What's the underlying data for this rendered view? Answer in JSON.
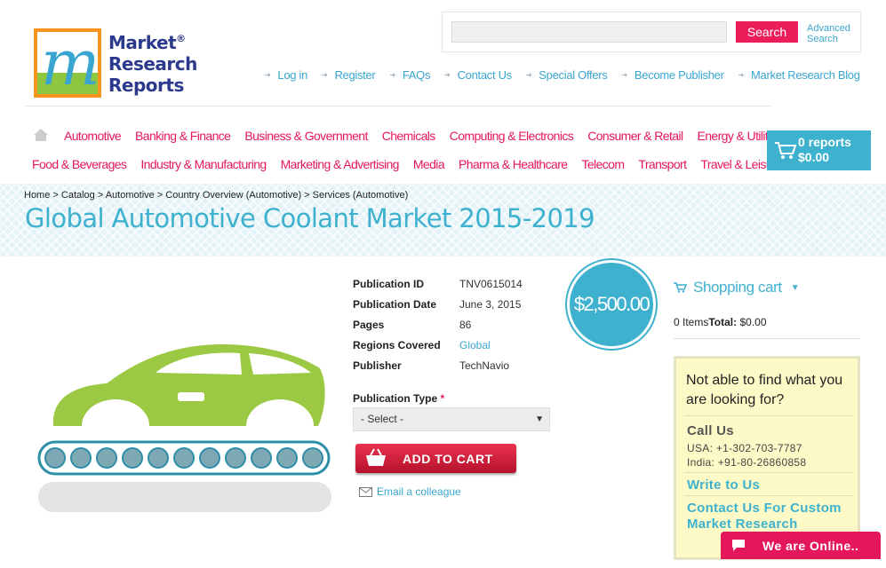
{
  "logo": {
    "line1": "Market",
    "line2": "Research",
    "line3": "Reports",
    "reg": "®"
  },
  "search": {
    "placeholder": "",
    "button": "Search",
    "advanced": "Advanced Search"
  },
  "top_links": [
    "Log in",
    "Register",
    "FAQs",
    "Contact Us",
    "Special Offers",
    "Become Publisher",
    "Market Research Blog"
  ],
  "categories_row1": [
    "Automotive",
    "Banking & Finance",
    "Business & Government",
    "Chemicals",
    "Computing & Electronics",
    "Consumer & Retail",
    "Energy & Utilities"
  ],
  "categories_row2": [
    "Food & Beverages",
    "Industry & Manufacturing",
    "Marketing & Advertising",
    "Media",
    "Pharma & Healthcare",
    "Telecom",
    "Transport",
    "Travel & Leisure"
  ],
  "cart": {
    "reports": "0 reports",
    "total": "$0.00"
  },
  "breadcrumb": "Home > Catalog > Automotive > Country Overview (Automotive) > Services (Automotive)",
  "title": "Global Automotive Coolant Market 2015-2019",
  "price": "$2,500.00",
  "details": [
    {
      "label": "Publication ID",
      "value": "TNV0615014"
    },
    {
      "label": "Publication Date",
      "value": "June 3, 2015"
    },
    {
      "label": "Pages",
      "value": "86"
    },
    {
      "label": "Regions Covered",
      "value": "Global"
    },
    {
      "label": "Publisher",
      "value": "TechNavio"
    }
  ],
  "pub_type": {
    "label": "Publication Type",
    "required": "*",
    "selected": "- Select -"
  },
  "add_to_cart": "ADD TO CART",
  "email_colleague": "Email a colleague",
  "shopping_cart": {
    "heading": "Shopping cart",
    "items": "0 Items",
    "total_label": "Total:",
    "total_value": "$0.00"
  },
  "help": {
    "question": "Not able to find what you are looking for?",
    "call_us": "Call Us",
    "usa": "USA: +1-302-703-7787",
    "india": "India: +91-80-26860858",
    "write": "Write to Us",
    "custom": "Contact Us For Custom Market Research"
  },
  "chat": "We are Online..",
  "colors": {
    "accent": "#3eb1cf",
    "brand_pink": "#e5175b",
    "car_green": "#9cc943"
  }
}
